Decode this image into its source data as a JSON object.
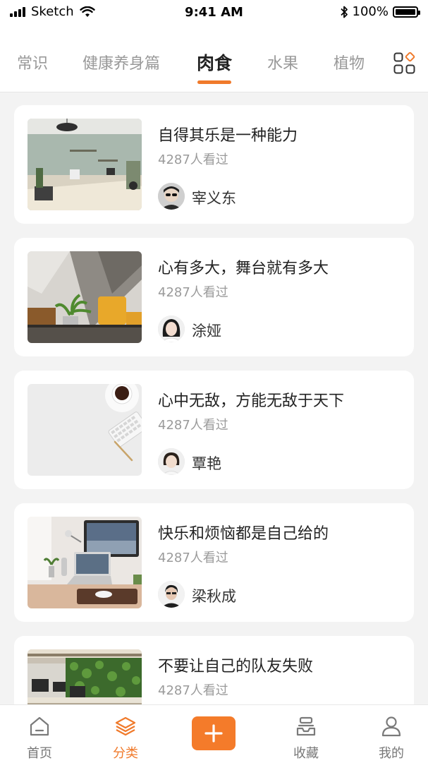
{
  "status_bar": {
    "carrier": "Sketch",
    "time": "9:41 AM",
    "battery": "100%"
  },
  "tabs": {
    "items": [
      {
        "label": "常识"
      },
      {
        "label": "健康养身篇"
      },
      {
        "label": "肉食"
      },
      {
        "label": "水果"
      },
      {
        "label": "植物"
      }
    ],
    "active": "肉食",
    "more_icon": "grid-icon"
  },
  "articles": [
    {
      "title": "自得其乐是一种能力",
      "views": "4287人看过",
      "author": "宰义东",
      "image": "office-interior-photo"
    },
    {
      "title": "心有多大，舞台就有多大",
      "views": "4287人看过",
      "author": "涂娅",
      "image": "lounge-yellow-chair-photo"
    },
    {
      "title": "心中无敌，方能无敌于天下",
      "views": "4287人看过",
      "author": "覃艳",
      "image": "desk-coffee-keyboard-photo"
    },
    {
      "title": "快乐和烦恼都是自己给的",
      "views": "4287人看过",
      "author": "梁秋成",
      "image": "workspace-laptop-monitor-photo"
    },
    {
      "title": "不要让自己的队友失败",
      "views": "4287人看过",
      "author": "",
      "image": "office-green-wall-photo"
    }
  ],
  "bottom_nav": {
    "home": "首页",
    "category": "分类",
    "add": "plus-icon",
    "favorites": "收藏",
    "mine": "我的"
  },
  "colors": {
    "accent": "#f07a2b",
    "background": "#f3f3f3",
    "title_text": "#222222",
    "muted_text": "#9a9a9a"
  }
}
